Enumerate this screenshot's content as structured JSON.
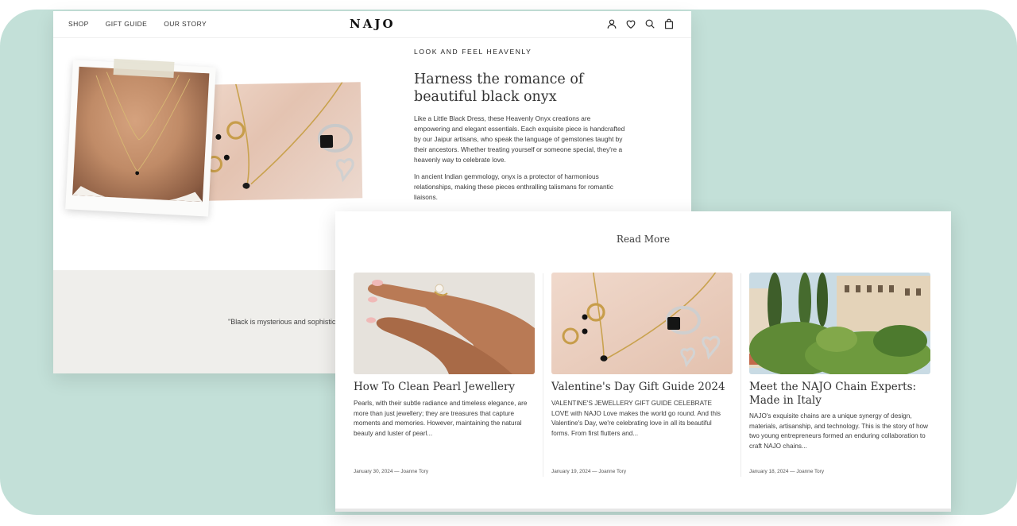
{
  "colors": {
    "backdrop": "#c3e0d8",
    "quote_band": "#efeeeb",
    "text": "#2b2b2b"
  },
  "nav": {
    "links": [
      "SHOP",
      "GIFT GUIDE",
      "OUR STORY"
    ],
    "logo": "NAJO",
    "icons": [
      "account-icon",
      "heart-icon",
      "search-icon",
      "bag-icon"
    ]
  },
  "feature": {
    "eyebrow": "LOOK AND FEEL HEAVENLY",
    "headline": "Harness the romance of beautiful black onyx",
    "paragraph_1": "Like a Little Black Dress, these Heavenly Onyx creations are empowering and elegant essentials. Each exquisite piece is handcrafted by our Jaipur artisans, who speak the language of gemstones taught by their ancestors. Whether treating yourself or someone special, they're a heavenly way to celebrate love.",
    "paragraph_2": "In ancient Indian gemmology, onyx is a protector of harmonious relationships, making these pieces enthralling talismans for romantic liaisons."
  },
  "quote": {
    "text": "\"Black is mysterious and sophistica... designs, black gemstones are emp... st..."
  },
  "read_more": {
    "title": "Read More",
    "cards": [
      {
        "title": "How To Clean Pearl Jewellery",
        "excerpt": "Pearls, with their subtle radiance and timeless elegance, are more than just jewellery; they are treasures that capture moments and memories. However, maintaining the natural beauty and luster of pearl...",
        "meta": "January 30, 2024 — Joanne Tory"
      },
      {
        "title": "Valentine's Day Gift Guide 2024",
        "excerpt": "VALENTINE'S JEWELLERY GIFT GUIDE CELEBRATE LOVE with NAJO Love makes the world go round. And this Valentine's Day, we're celebrating love in all its beautiful forms. From first flutters and...",
        "meta": "January 19, 2024 — Joanne Tory"
      },
      {
        "title": "Meet the NAJO Chain Experts: Made in Italy",
        "excerpt": "NAJO's exquisite chains are a unique synergy of design, materials, artisanship, and technology. This is the story of how two young entrepreneurs formed an enduring collaboration to craft NAJO chains...",
        "meta": "January 18, 2024 — Joanne Tory"
      }
    ]
  }
}
